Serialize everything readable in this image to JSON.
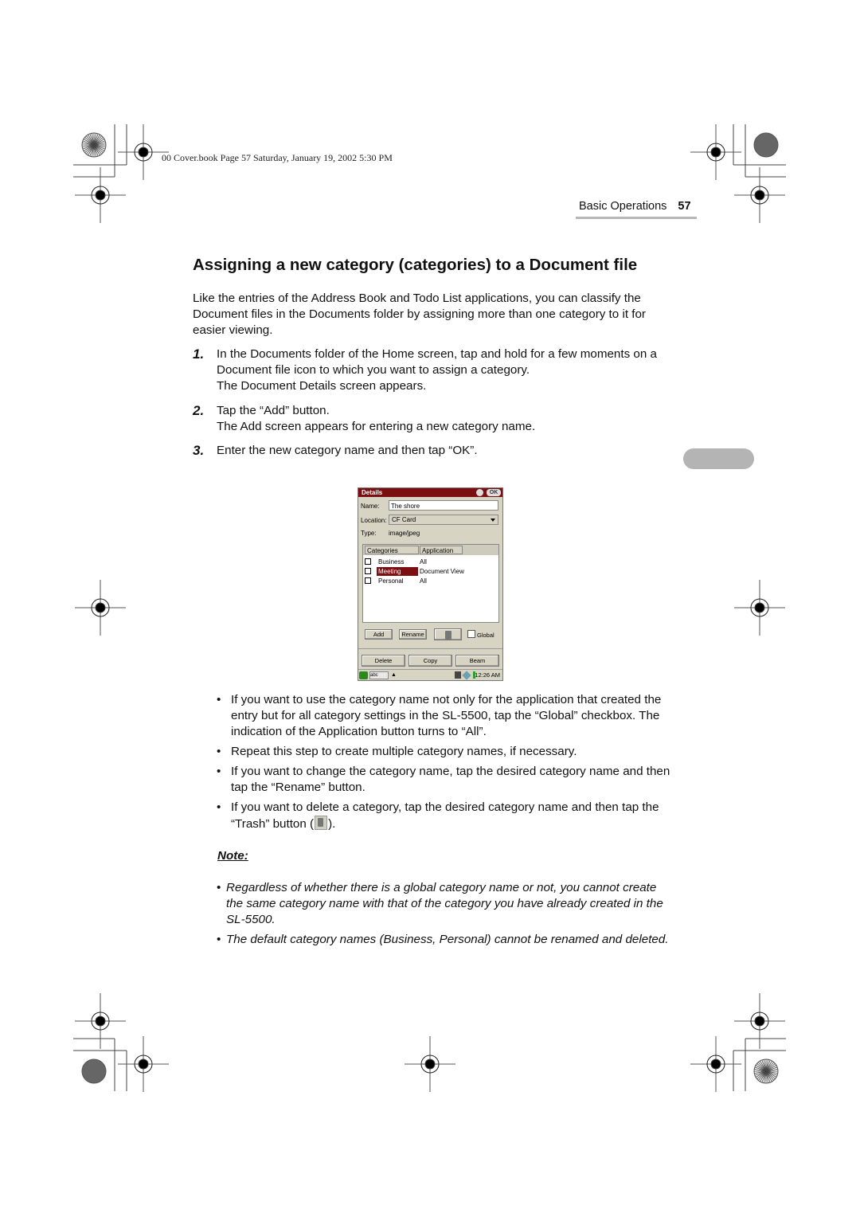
{
  "print_header": {
    "meta": "00 Cover.book  Page 57  Saturday, January 19, 2002  5:30 PM"
  },
  "running_header": {
    "section": "Basic Operations",
    "page_number": "57"
  },
  "title": "Assigning a new category (categories) to a Document file",
  "intro": "Like the entries of the Address Book and Todo List applications, you can classify the Document files in the Documents folder by assigning more than one category to it for easier viewing.",
  "steps": [
    {
      "num": "1.",
      "text": "In the Documents folder of the Home screen, tap and hold for a few moments on a Document file icon to which you want to assign a category.",
      "result": "The Document Details screen appears."
    },
    {
      "num": "2.",
      "text": "Tap the “Add” button.",
      "result": "The Add screen appears for entering a new category name."
    },
    {
      "num": "3.",
      "text": "Enter the new category name and then tap “OK”.",
      "result": ""
    }
  ],
  "device_screen": {
    "title": "Details",
    "ok_label": "OK",
    "name_label": "Name:",
    "name_value": "The shore",
    "location_label": "Location:",
    "location_value": "CF Card",
    "type_label": "Type:",
    "type_value": "image/jpeg",
    "columns": [
      "Categories",
      "Application"
    ],
    "rows": [
      {
        "category": "Business",
        "application": "All",
        "checked": false,
        "selected": false
      },
      {
        "category": "Meeting",
        "application": "Document View",
        "checked": false,
        "selected": true
      },
      {
        "category": "Personal",
        "application": "All",
        "checked": false,
        "selected": false
      }
    ],
    "buttons": {
      "add": "Add",
      "rename": "Rename",
      "global": "Global"
    },
    "bottom_buttons": {
      "delete": "Delete",
      "copy": "Copy",
      "beam": "Beam"
    },
    "taskbar": {
      "ime": "abc",
      "clock": "12:26 AM"
    }
  },
  "bullets": [
    "If you want to use the category name not only for the application that created the entry but for all category settings in the SL-5500, tap the “Global” checkbox. The indication of the Application button turns to “All”.",
    "Repeat this step to create multiple category names, if necessary.",
    "If you want to change the category name, tap the desired category name and then tap the “Rename” button."
  ],
  "bullet_trash": {
    "before": "If you want to delete a category, tap the desired category name and then tap the “Trash” button (",
    "after": ")."
  },
  "note": {
    "label": "Note:",
    "items": [
      "Regardless of whether there is a global category name or not, you cannot create the same category name with that of the category you have already created in the SL-5500.",
      "The default category names (Business, Personal) cannot be renamed and deleted."
    ]
  },
  "colors": {
    "device_titlebar": "#7a0e10",
    "device_bg": "#d8d4c4",
    "tab_pill": "#b4b4b4",
    "header_rule": "#b8b8b8"
  }
}
